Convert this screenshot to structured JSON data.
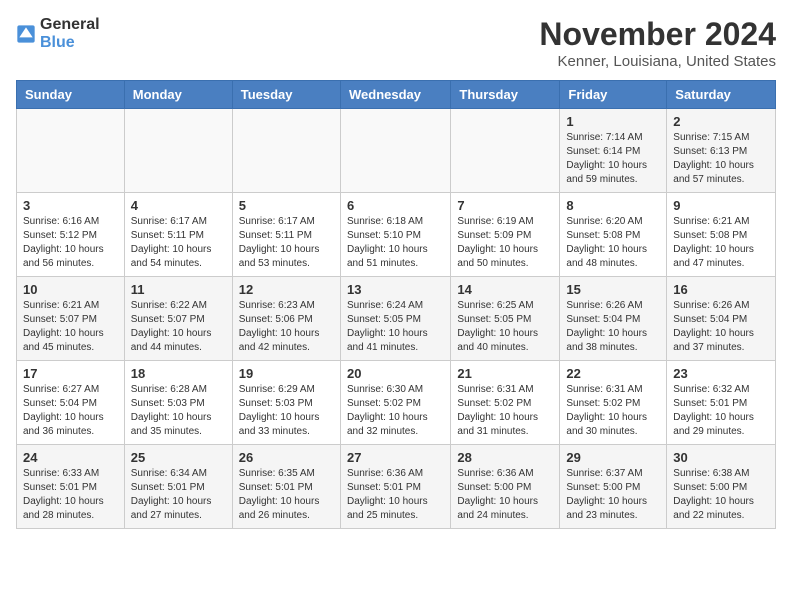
{
  "logo": {
    "general": "General",
    "blue": "Blue"
  },
  "title": "November 2024",
  "location": "Kenner, Louisiana, United States",
  "weekdays": [
    "Sunday",
    "Monday",
    "Tuesday",
    "Wednesday",
    "Thursday",
    "Friday",
    "Saturday"
  ],
  "weeks": [
    [
      {
        "day": "",
        "info": ""
      },
      {
        "day": "",
        "info": ""
      },
      {
        "day": "",
        "info": ""
      },
      {
        "day": "",
        "info": ""
      },
      {
        "day": "",
        "info": ""
      },
      {
        "day": "1",
        "info": "Sunrise: 7:14 AM\nSunset: 6:14 PM\nDaylight: 10 hours\nand 59 minutes."
      },
      {
        "day": "2",
        "info": "Sunrise: 7:15 AM\nSunset: 6:13 PM\nDaylight: 10 hours\nand 57 minutes."
      }
    ],
    [
      {
        "day": "3",
        "info": "Sunrise: 6:16 AM\nSunset: 5:12 PM\nDaylight: 10 hours\nand 56 minutes."
      },
      {
        "day": "4",
        "info": "Sunrise: 6:17 AM\nSunset: 5:11 PM\nDaylight: 10 hours\nand 54 minutes."
      },
      {
        "day": "5",
        "info": "Sunrise: 6:17 AM\nSunset: 5:11 PM\nDaylight: 10 hours\nand 53 minutes."
      },
      {
        "day": "6",
        "info": "Sunrise: 6:18 AM\nSunset: 5:10 PM\nDaylight: 10 hours\nand 51 minutes."
      },
      {
        "day": "7",
        "info": "Sunrise: 6:19 AM\nSunset: 5:09 PM\nDaylight: 10 hours\nand 50 minutes."
      },
      {
        "day": "8",
        "info": "Sunrise: 6:20 AM\nSunset: 5:08 PM\nDaylight: 10 hours\nand 48 minutes."
      },
      {
        "day": "9",
        "info": "Sunrise: 6:21 AM\nSunset: 5:08 PM\nDaylight: 10 hours\nand 47 minutes."
      }
    ],
    [
      {
        "day": "10",
        "info": "Sunrise: 6:21 AM\nSunset: 5:07 PM\nDaylight: 10 hours\nand 45 minutes."
      },
      {
        "day": "11",
        "info": "Sunrise: 6:22 AM\nSunset: 5:07 PM\nDaylight: 10 hours\nand 44 minutes."
      },
      {
        "day": "12",
        "info": "Sunrise: 6:23 AM\nSunset: 5:06 PM\nDaylight: 10 hours\nand 42 minutes."
      },
      {
        "day": "13",
        "info": "Sunrise: 6:24 AM\nSunset: 5:05 PM\nDaylight: 10 hours\nand 41 minutes."
      },
      {
        "day": "14",
        "info": "Sunrise: 6:25 AM\nSunset: 5:05 PM\nDaylight: 10 hours\nand 40 minutes."
      },
      {
        "day": "15",
        "info": "Sunrise: 6:26 AM\nSunset: 5:04 PM\nDaylight: 10 hours\nand 38 minutes."
      },
      {
        "day": "16",
        "info": "Sunrise: 6:26 AM\nSunset: 5:04 PM\nDaylight: 10 hours\nand 37 minutes."
      }
    ],
    [
      {
        "day": "17",
        "info": "Sunrise: 6:27 AM\nSunset: 5:04 PM\nDaylight: 10 hours\nand 36 minutes."
      },
      {
        "day": "18",
        "info": "Sunrise: 6:28 AM\nSunset: 5:03 PM\nDaylight: 10 hours\nand 35 minutes."
      },
      {
        "day": "19",
        "info": "Sunrise: 6:29 AM\nSunset: 5:03 PM\nDaylight: 10 hours\nand 33 minutes."
      },
      {
        "day": "20",
        "info": "Sunrise: 6:30 AM\nSunset: 5:02 PM\nDaylight: 10 hours\nand 32 minutes."
      },
      {
        "day": "21",
        "info": "Sunrise: 6:31 AM\nSunset: 5:02 PM\nDaylight: 10 hours\nand 31 minutes."
      },
      {
        "day": "22",
        "info": "Sunrise: 6:31 AM\nSunset: 5:02 PM\nDaylight: 10 hours\nand 30 minutes."
      },
      {
        "day": "23",
        "info": "Sunrise: 6:32 AM\nSunset: 5:01 PM\nDaylight: 10 hours\nand 29 minutes."
      }
    ],
    [
      {
        "day": "24",
        "info": "Sunrise: 6:33 AM\nSunset: 5:01 PM\nDaylight: 10 hours\nand 28 minutes."
      },
      {
        "day": "25",
        "info": "Sunrise: 6:34 AM\nSunset: 5:01 PM\nDaylight: 10 hours\nand 27 minutes."
      },
      {
        "day": "26",
        "info": "Sunrise: 6:35 AM\nSunset: 5:01 PM\nDaylight: 10 hours\nand 26 minutes."
      },
      {
        "day": "27",
        "info": "Sunrise: 6:36 AM\nSunset: 5:01 PM\nDaylight: 10 hours\nand 25 minutes."
      },
      {
        "day": "28",
        "info": "Sunrise: 6:36 AM\nSunset: 5:00 PM\nDaylight: 10 hours\nand 24 minutes."
      },
      {
        "day": "29",
        "info": "Sunrise: 6:37 AM\nSunset: 5:00 PM\nDaylight: 10 hours\nand 23 minutes."
      },
      {
        "day": "30",
        "info": "Sunrise: 6:38 AM\nSunset: 5:00 PM\nDaylight: 10 hours\nand 22 minutes."
      }
    ]
  ]
}
